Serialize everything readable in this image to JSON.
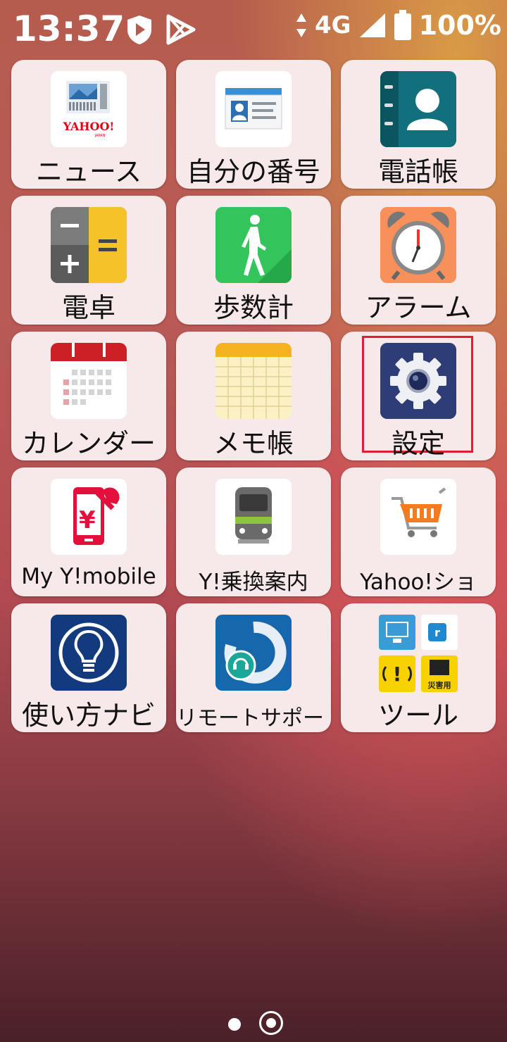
{
  "status_bar": {
    "time": "13:37",
    "network": "4G",
    "battery": "100%",
    "icons": [
      "shield-play-icon",
      "play-store-icon",
      "data-arrows-icon",
      "signal-icon",
      "battery-icon"
    ]
  },
  "apps": [
    {
      "label": "ニュース",
      "icon": "news-icon"
    },
    {
      "label": "自分の番号",
      "icon": "id-card-icon"
    },
    {
      "label": "電話帳",
      "icon": "contacts-icon"
    },
    {
      "label": "電卓",
      "icon": "calculator-icon"
    },
    {
      "label": "歩数計",
      "icon": "walking-icon"
    },
    {
      "label": "アラーム",
      "icon": "alarm-clock-icon"
    },
    {
      "label": "カレンダー",
      "icon": "calendar-icon"
    },
    {
      "label": "メモ帳",
      "icon": "memo-icon"
    },
    {
      "label": "設定",
      "icon": "gear-icon"
    },
    {
      "label": "My Y!mobile",
      "icon": "phone-wrench-icon"
    },
    {
      "label": "Y!乗換案内",
      "icon": "train-icon"
    },
    {
      "label": "Yahoo!ショ",
      "icon": "shopping-cart-icon"
    },
    {
      "label": "使い方ナビ",
      "icon": "lightbulb-icon"
    },
    {
      "label": "リモートサポート",
      "icon": "remote-support-icon"
    },
    {
      "label": "ツール",
      "icon": "tools-folder-icon"
    }
  ],
  "news_logo": "YAHOO!",
  "news_logo_sub": "JAPAN",
  "tools_disaster_text": "災害用",
  "pages": {
    "count": 2,
    "current": 2
  }
}
